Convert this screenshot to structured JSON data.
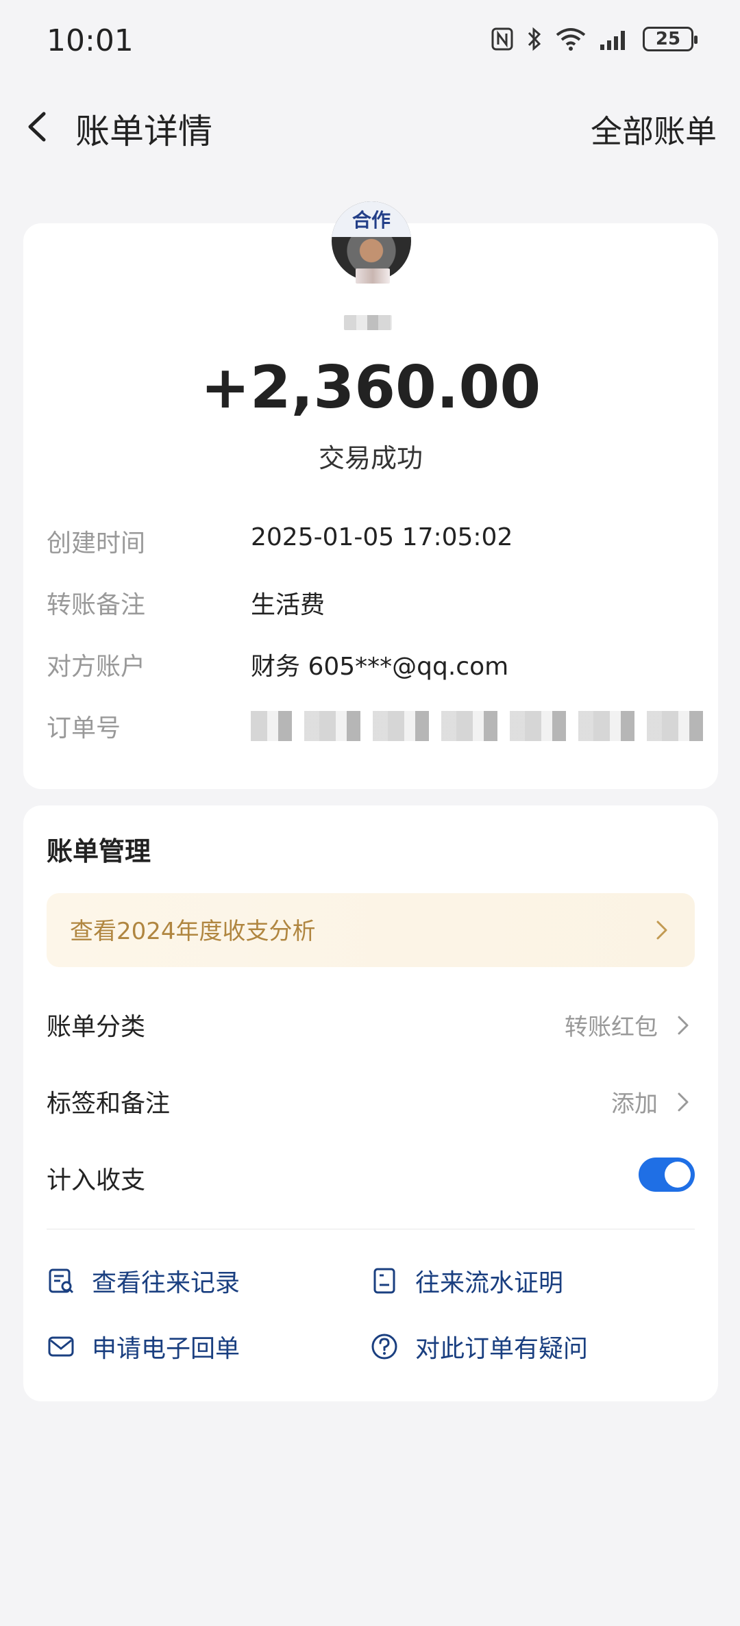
{
  "status_bar": {
    "time": "10:01",
    "battery": "25",
    "icons": [
      "nfc-icon",
      "bluetooth-icon",
      "wifi-icon",
      "signal-icon",
      "battery-icon"
    ]
  },
  "nav": {
    "title": "账单详情",
    "right_link": "全部账单"
  },
  "transaction": {
    "amount": "+2,360.00",
    "status": "交易成功",
    "details": [
      {
        "label": "创建时间",
        "value": "2025-01-05 17:05:02"
      },
      {
        "label": "转账备注",
        "value": "生活费"
      },
      {
        "label": "对方账户",
        "value": "财务 605***@qq.com"
      },
      {
        "label": "订单号",
        "value": ""
      }
    ]
  },
  "manage": {
    "title": "账单管理",
    "promo": "查看2024年度收支分析",
    "rows": [
      {
        "label": "账单分类",
        "value": "转账红包"
      },
      {
        "label": "标签和备注",
        "value": "添加"
      },
      {
        "label": "计入收支",
        "value": ""
      }
    ],
    "toggle_on": true,
    "actions": [
      {
        "label": "查看往来记录",
        "icon": "record-search-icon"
      },
      {
        "label": "往来流水证明",
        "icon": "document-icon"
      },
      {
        "label": "申请电子回单",
        "icon": "mail-icon"
      },
      {
        "label": "对此订单有疑问",
        "icon": "help-icon"
      }
    ]
  },
  "colors": {
    "accent": "#1f6fe5",
    "action_text": "#1a3f80",
    "promo_text": "#b08640",
    "background": "#f4f4f6"
  }
}
